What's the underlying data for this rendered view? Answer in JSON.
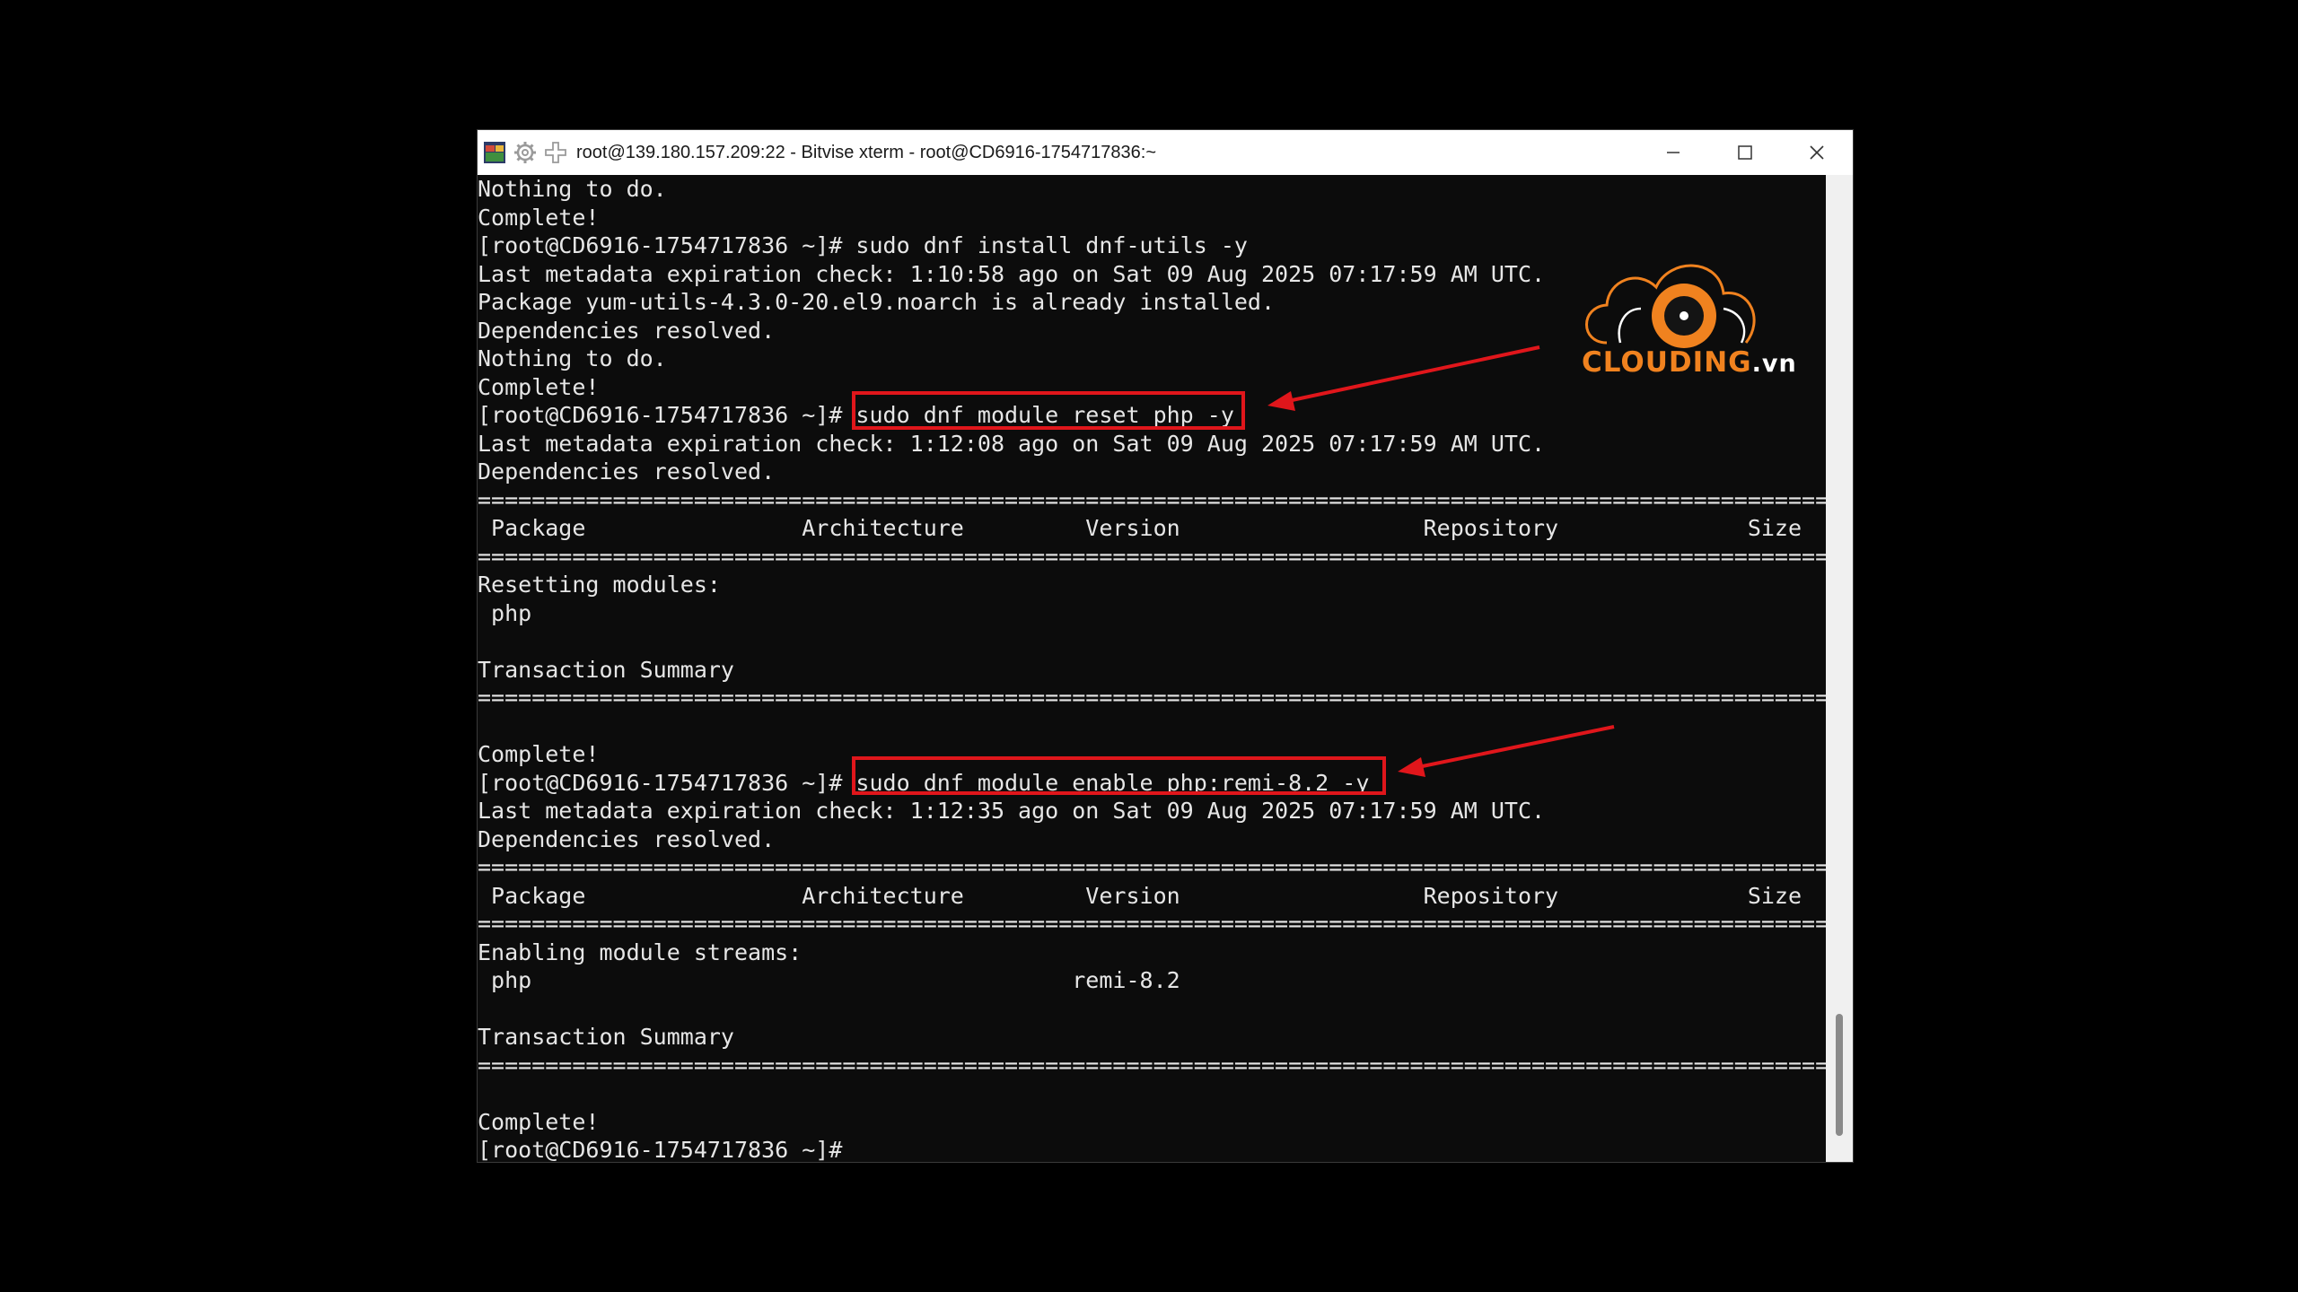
{
  "window": {
    "title": "root@139.180.157.209:22 - Bitvise xterm - root@CD6916-1754717836:~",
    "controls": [
      "minimize",
      "maximize",
      "close"
    ]
  },
  "terminal": {
    "lines": [
      "Nothing to do.",
      "Complete!",
      "[root@CD6916-1754717836 ~]# sudo dnf install dnf-utils -y",
      "Last metadata expiration check: 1:10:58 ago on Sat 09 Aug 2025 07:17:59 AM UTC.",
      "Package yum-utils-4.3.0-20.el9.noarch is already installed.",
      "Dependencies resolved.",
      "Nothing to do.",
      "Complete!",
      "[root@CD6916-1754717836 ~]# sudo dnf module reset php -y",
      "Last metadata expiration check: 1:12:08 ago on Sat 09 Aug 2025 07:17:59 AM UTC.",
      "Dependencies resolved.",
      "====================================================================================================",
      " Package                Architecture         Version                  Repository              Size",
      "====================================================================================================",
      "Resetting modules:",
      " php",
      "",
      "Transaction Summary",
      "====================================================================================================",
      "",
      "Complete!",
      "[root@CD6916-1754717836 ~]# sudo dnf module enable php:remi-8.2 -y",
      "Last metadata expiration check: 1:12:35 ago on Sat 09 Aug 2025 07:17:59 AM UTC.",
      "Dependencies resolved.",
      "====================================================================================================",
      " Package                Architecture         Version                  Repository              Size",
      "====================================================================================================",
      "Enabling module streams:",
      " php                                        remi-8.2",
      "",
      "Transaction Summary",
      "====================================================================================================",
      "",
      "Complete!",
      "[root@CD6916-1754717836 ~]#"
    ]
  },
  "logo": {
    "brand": "CLOUDING",
    "suffix": ".vn"
  },
  "colors": {
    "highlight": "#e0161b",
    "logo_orange": "#f0821f",
    "terminal_bg": "#0c0c0c",
    "terminal_fg": "#e6e6e6"
  }
}
